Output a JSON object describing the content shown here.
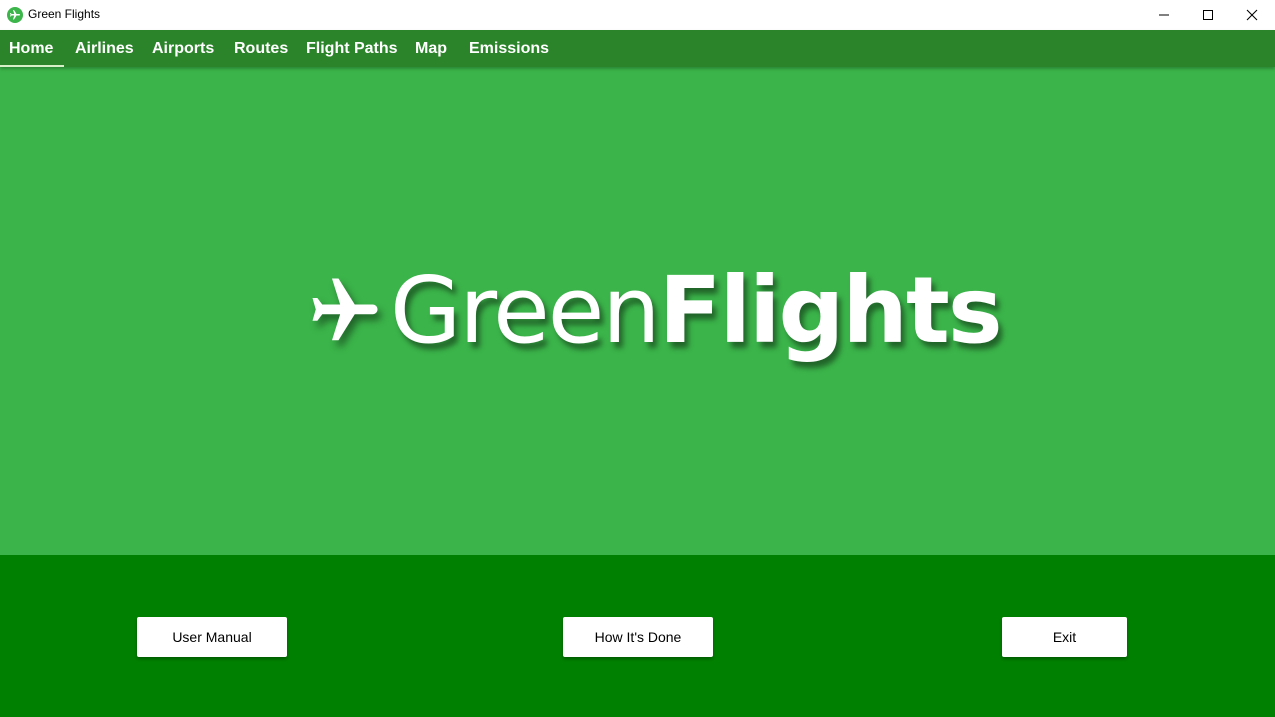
{
  "window": {
    "title": "Green Flights",
    "icon": "airplane-icon",
    "controls": [
      "minimize-icon",
      "maximize-icon",
      "close-icon"
    ]
  },
  "nav": {
    "items": [
      {
        "label": "Home",
        "active": true
      },
      {
        "label": "Airlines",
        "active": false
      },
      {
        "label": "Airports",
        "active": false
      },
      {
        "label": "Routes",
        "active": false
      },
      {
        "label": "Flight Paths",
        "active": false
      },
      {
        "label": "Map",
        "active": false
      },
      {
        "label": "Emissions",
        "active": false
      }
    ]
  },
  "hero": {
    "logo_icon": "airplane-icon",
    "logo_light": "Green",
    "logo_bold": "Flights"
  },
  "footer": {
    "user_manual_label": "User Manual",
    "how_label": "How It's Done",
    "exit_label": "Exit"
  },
  "colors": {
    "nav_bg": "#2b8429",
    "hero_bg": "#3bb54a",
    "footer_bg": "#008000",
    "active_underline": "#d8f0c8"
  }
}
